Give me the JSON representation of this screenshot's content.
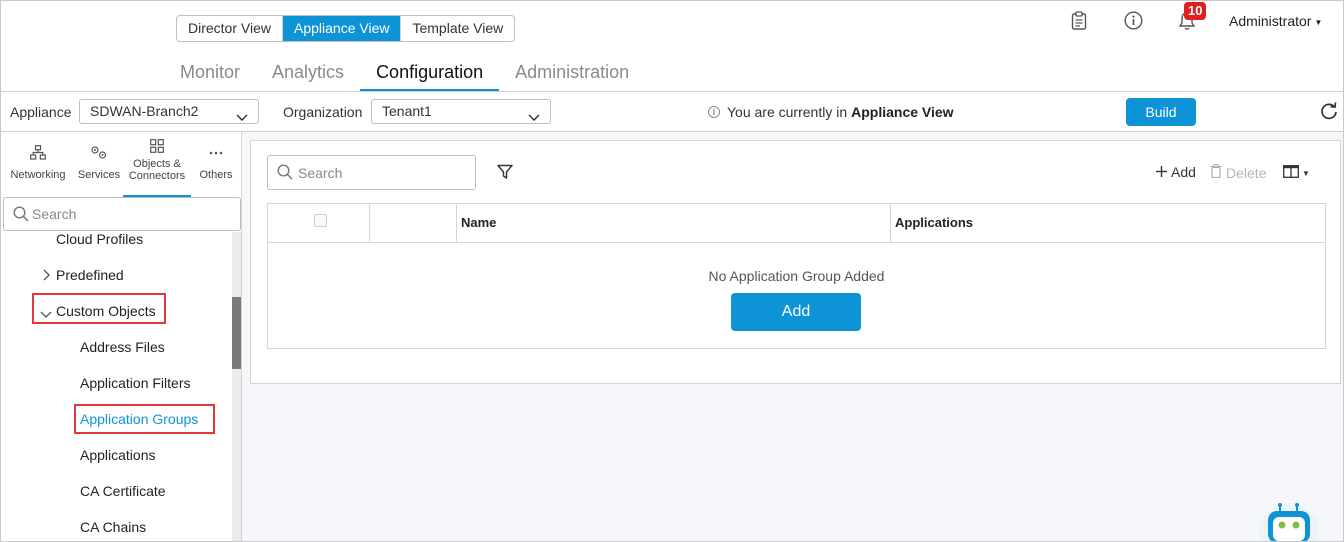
{
  "view_toggle": {
    "director": "Director View",
    "appliance": "Appliance View",
    "template": "Template View"
  },
  "notifications": {
    "count": "10"
  },
  "user": {
    "name": "Administrator"
  },
  "main_nav": {
    "monitor": "Monitor",
    "analytics": "Analytics",
    "configuration": "Configuration",
    "administration": "Administration"
  },
  "selectors": {
    "appliance_label": "Appliance",
    "appliance_value": "SDWAN-Branch2",
    "organization_label": "Organization",
    "organization_value": "Tenant1"
  },
  "info": {
    "prefix": "You are currently in",
    "view": "Appliance View"
  },
  "build_label": "Build",
  "sidebar": {
    "tabs": {
      "networking": "Networking",
      "services": "Services",
      "objects_line1": "Objects &",
      "objects_line2": "Connectors",
      "others": "Others"
    },
    "search_placeholder": "Search",
    "tree": {
      "cloud_profiles": "Cloud Profiles",
      "predefined": "Predefined",
      "custom_objects": "Custom Objects",
      "address_files": "Address Files",
      "application_filters": "Application Filters",
      "application_groups": "Application Groups",
      "applications": "Applications",
      "ca_certificate": "CA Certificate",
      "ca_chains": "CA Chains"
    }
  },
  "content": {
    "search_placeholder": "Search",
    "add_label": "Add",
    "delete_label": "Delete",
    "columns": {
      "name": "Name",
      "applications": "Applications"
    },
    "empty_message": "No Application Group Added",
    "add_button": "Add"
  },
  "colors": {
    "accent": "#0e93d6",
    "highlight_box": "#e03a3a",
    "badge": "#e02020"
  }
}
